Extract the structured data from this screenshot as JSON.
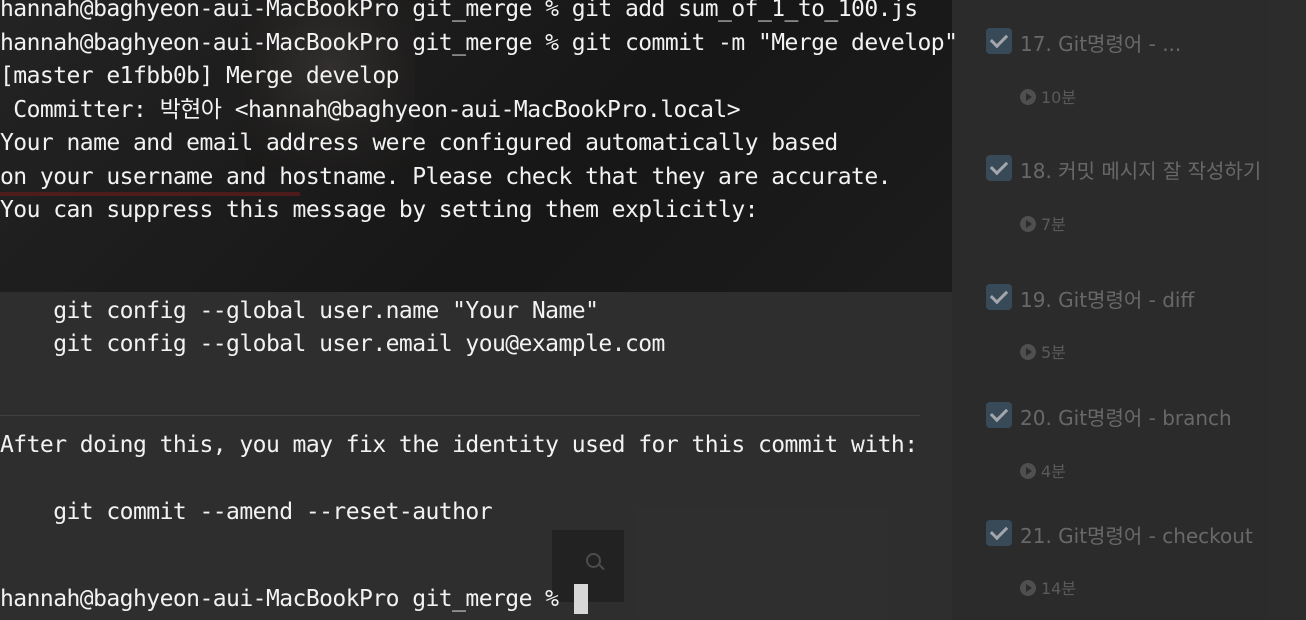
{
  "background_app": {
    "lessons": [
      {
        "title": "17. Git명령어 - ...",
        "duration": "10분"
      },
      {
        "title": "18. 커밋 메시지 잘 작성하기",
        "duration": "7분"
      },
      {
        "title": "19. Git명령어 - diff",
        "duration": "5분"
      },
      {
        "title": "20. Git명령어 - branch",
        "duration": "4분"
      },
      {
        "title": "21. Git명령어 - checkout",
        "duration": "14분"
      }
    ]
  },
  "terminal": {
    "lines": [
      "hannah@baghyeon-aui-MacBookPro git_merge % git add sum_of_1_to_100.js",
      "hannah@baghyeon-aui-MacBookPro git_merge % git commit -m \"Merge develop\"",
      "[master e1fbb0b] Merge develop",
      " Committer: 박현아 <hannah@baghyeon-aui-MacBookPro.local>",
      "Your name and email address were configured automatically based",
      "on your username and hostname. Please check that they are accurate.",
      "You can suppress this message by setting them explicitly:",
      "",
      "    git config --global user.name \"Your Name\"",
      "    git config --global user.email you@example.com",
      "",
      "After doing this, you may fix the identity used for this commit with:",
      "",
      "    git commit --amend --reset-author",
      "",
      "hannah@baghyeon-aui-MacBookPro git_merge % "
    ]
  }
}
